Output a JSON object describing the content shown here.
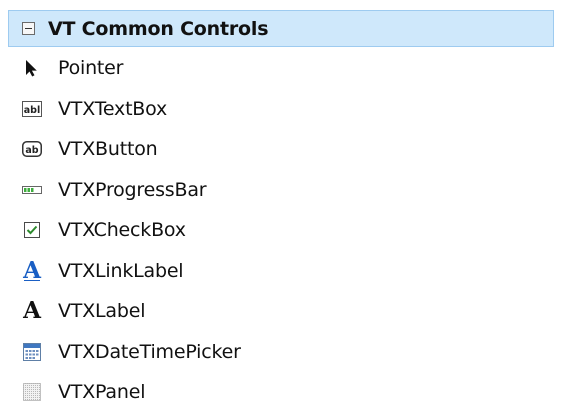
{
  "group": {
    "title": "VT Common Controls",
    "expanded": true,
    "header_bg": "#cfe8fb"
  },
  "items": [
    {
      "label": "Pointer",
      "icon": "pointer-icon"
    },
    {
      "label": "VTXTextBox",
      "icon": "textbox-icon",
      "icon_text": "abl"
    },
    {
      "label": "VTXButton",
      "icon": "button-icon",
      "icon_text": "ab"
    },
    {
      "label": "VTXProgressBar",
      "icon": "progressbar-icon"
    },
    {
      "label": "VTXCheckBox",
      "icon": "checkbox-icon"
    },
    {
      "label": "VTXLinkLabel",
      "icon": "linklabel-icon",
      "icon_text": "A",
      "icon_color": "#1a5fc4"
    },
    {
      "label": "VTXLabel",
      "icon": "label-icon",
      "icon_text": "A"
    },
    {
      "label": "VTXDateTimePicker",
      "icon": "datetimepicker-icon"
    },
    {
      "label": "VTXPanel",
      "icon": "panel-icon"
    }
  ]
}
